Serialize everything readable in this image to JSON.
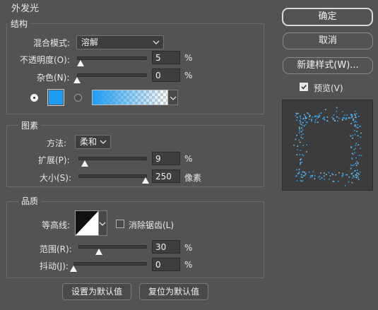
{
  "title": "外发光",
  "structure": {
    "heading": "结构",
    "blend_mode_label": "混合模式:",
    "blend_mode_value": "溶解",
    "opacity_label": "不透明度(O):",
    "opacity_value": "5",
    "opacity_unit": "%",
    "opacity_level": 0.05,
    "noise_label": "杂色(N):",
    "noise_value": "0",
    "noise_unit": "%",
    "noise_level": 0,
    "glow_color": "#1e9cf0"
  },
  "elements": {
    "heading": "图素",
    "method_label": "方法:",
    "method_value": "柔和",
    "spread_label": "扩展(P):",
    "spread_value": "9",
    "spread_unit": "%",
    "spread_level": 0.09,
    "size_label": "大小(S):",
    "size_value": "250",
    "size_unit": "像素",
    "size_level": 1.0
  },
  "quality": {
    "heading": "品质",
    "contour_label": "等高线:",
    "antialias_label": "消除锯齿(L)",
    "range_label": "范围(R):",
    "range_value": "30",
    "range_unit": "%",
    "range_level": 0.3,
    "jitter_label": "抖动(J):",
    "jitter_value": "0",
    "jitter_unit": "%",
    "jitter_level": 0
  },
  "footer": {
    "make_default": "设置为默认值",
    "reset_default": "复位为默认值"
  },
  "side": {
    "ok": "确定",
    "cancel": "取消",
    "new_style": "新建样式(W)...",
    "preview_label": "预览(V)"
  }
}
